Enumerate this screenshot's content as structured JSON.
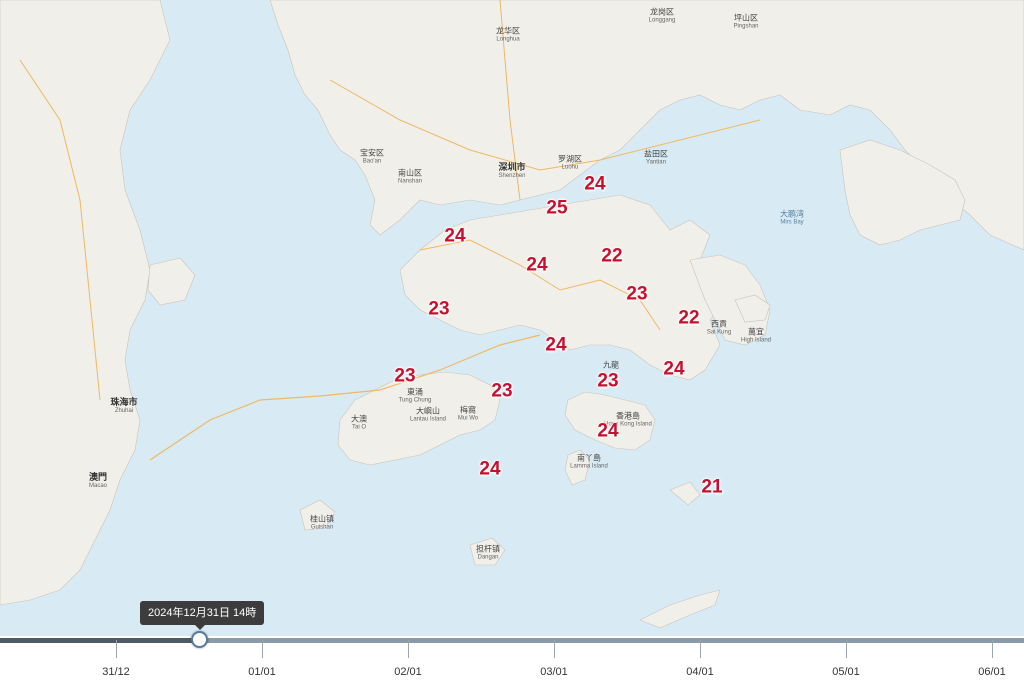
{
  "colors": {
    "sea": "#d8ebf5",
    "land": "#f1efe9",
    "temperature_text": "#c8102e",
    "tooltip_bg": "#3c3c3c"
  },
  "temperatures": [
    {
      "value": "24"
    },
    {
      "value": "25"
    },
    {
      "value": "24"
    },
    {
      "value": "24"
    },
    {
      "value": "22"
    },
    {
      "value": "23"
    },
    {
      "value": "23"
    },
    {
      "value": "22"
    },
    {
      "value": "24"
    },
    {
      "value": "24"
    },
    {
      "value": "23"
    },
    {
      "value": "23"
    },
    {
      "value": "23"
    },
    {
      "value": "24"
    },
    {
      "value": "24"
    },
    {
      "value": "21"
    }
  ],
  "places": [
    {
      "zh": "龙华区",
      "en": "Longhua"
    },
    {
      "zh": "龙岗区",
      "en": "Longgang"
    },
    {
      "zh": "坪山区",
      "en": "Pingshan"
    },
    {
      "zh": "宝安区",
      "en": "Bao'an"
    },
    {
      "zh": "南山区",
      "en": "Nanshan"
    },
    {
      "zh": "深圳市",
      "en": "Shenzhen"
    },
    {
      "zh": "罗湖区",
      "en": "Luohu"
    },
    {
      "zh": "盐田区",
      "en": "Yantian"
    },
    {
      "zh": "大鹏湾",
      "en": "Mirs Bay"
    },
    {
      "zh": "珠海市",
      "en": "Zhuhai"
    },
    {
      "zh": "澳門",
      "en": "Macao"
    },
    {
      "zh": "大嶼山",
      "en": "Lantau Island"
    },
    {
      "zh": "九龍",
      "en": ""
    },
    {
      "zh": "香港島",
      "en": "Hong Kong Island"
    },
    {
      "zh": "東涌",
      "en": "Tung Chung"
    },
    {
      "zh": "大澳",
      "en": "Tai O"
    },
    {
      "zh": "梅窩",
      "en": "Mui Wo"
    },
    {
      "zh": "南丫島",
      "en": "Lamma Island"
    },
    {
      "zh": "桂山镇",
      "en": "Guishan"
    },
    {
      "zh": "担杆镇",
      "en": "Dangan"
    },
    {
      "zh": "萬宜",
      "en": "High Island"
    },
    {
      "zh": "西貢",
      "en": "Sai Kung"
    }
  ],
  "timeline": {
    "tooltip": "2024年12月31日 14時",
    "ticks": [
      "31/12",
      "01/01",
      "02/01",
      "03/01",
      "04/01",
      "05/01",
      "06/01"
    ]
  }
}
